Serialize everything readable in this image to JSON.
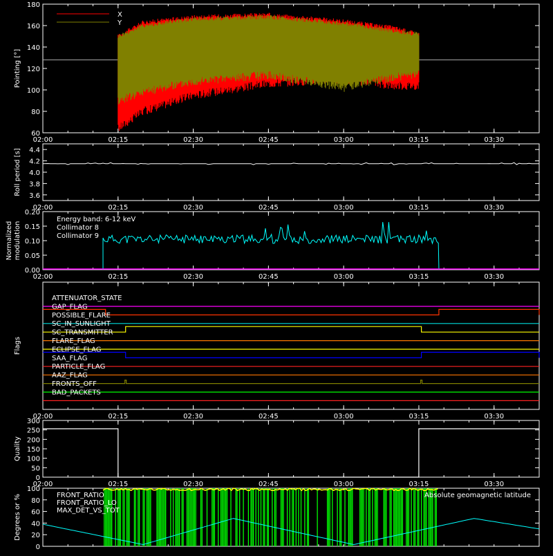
{
  "chart_data": [
    {
      "type": "line",
      "ylabel": "Pointing [°]",
      "ylim": [
        60,
        180
      ],
      "yticks": [
        "60",
        "80",
        "100",
        "120",
        "140",
        "160",
        "180"
      ],
      "xlim_minutes": [
        0,
        99
      ],
      "xticks": [
        "02:00",
        "02:15",
        "02:30",
        "02:45",
        "03:00",
        "03:15",
        "03:30"
      ],
      "legend": [
        {
          "label": "X",
          "color": "#ff0000"
        },
        {
          "label": "Y",
          "color": "#808000"
        }
      ],
      "reference_line": {
        "y": 128,
        "color": "#aaaaaa"
      },
      "series": [
        {
          "name": "X",
          "color": "#ff0000",
          "active_range": [
            "02:15",
            "03:15"
          ],
          "x": [
            "02:15",
            "02:20",
            "02:30",
            "02:45",
            "03:00",
            "03:10",
            "03:15"
          ],
          "upper": [
            150,
            163,
            168,
            170,
            164,
            158,
            152
          ],
          "lower": [
            64,
            80,
            95,
            106,
            110,
            104,
            104
          ]
        },
        {
          "name": "Y",
          "color": "#808000",
          "active_range": [
            "02:15",
            "03:15"
          ],
          "x": [
            "02:15",
            "02:20",
            "02:30",
            "02:45",
            "03:00",
            "03:10",
            "03:15"
          ],
          "upper": [
            150,
            160,
            166,
            168,
            162,
            155,
            152
          ],
          "lower": [
            90,
            98,
            108,
            114,
            102,
            112,
            114
          ]
        }
      ]
    },
    {
      "type": "line",
      "ylabel": "Roll period [s]",
      "ylim": [
        3.5,
        4.5
      ],
      "yticks": [
        "3.6",
        "3.8",
        "4.0",
        "4.2",
        "4.4"
      ],
      "xticks": [
        "02:00",
        "02:15",
        "02:30",
        "02:45",
        "03:00",
        "03:15",
        "03:30"
      ],
      "series": [
        {
          "color": "#ffffff",
          "value": 4.15
        }
      ]
    },
    {
      "type": "line",
      "ylabel": "Normalized modulation",
      "ylim": [
        0,
        0.2
      ],
      "yticks": [
        "0.00",
        "0.05",
        "0.10",
        "0.15",
        "0.20"
      ],
      "xticks": [
        "02:00",
        "02:15",
        "02:30",
        "02:45",
        "03:00",
        "03:15",
        "03:30"
      ],
      "annotation": "Energy band: 6-12 keV",
      "legend": [
        {
          "label": "Collimator 8",
          "color": "#00ffff"
        },
        {
          "label": "Collimator 9",
          "color": "#ff00ff"
        }
      ],
      "series": [
        {
          "name": "Collimator 8",
          "color": "#00ffff",
          "active_range": [
            "02:12",
            "03:19"
          ],
          "baseline": 0.105,
          "spread": 0.03
        },
        {
          "name": "Collimator 9",
          "color": "#ff00ff",
          "value": 0.0
        }
      ]
    },
    {
      "type": "line",
      "ylabel": "Flags",
      "xticks": [
        "02:00",
        "02:15",
        "02:30",
        "02:45",
        "03:00",
        "03:15",
        "03:30"
      ],
      "flags": [
        {
          "label": "ATTENUATOR_STATE",
          "color": "#ff00ff"
        },
        {
          "label": "GAP_FLAG",
          "color": "#ff3300",
          "high": [
            [
              0,
              12.5
            ],
            [
              79,
              99
            ]
          ]
        },
        {
          "label": "POSSIBLE_FLARE",
          "color": "#00dddd"
        },
        {
          "label": "SC_IN_SUNLIGHT",
          "color": "#ffff00",
          "high": [
            [
              16.5,
              75.5
            ]
          ]
        },
        {
          "label": "SC_TRANSMITTER",
          "color": "#ff7700"
        },
        {
          "label": "FLARE_FLAG",
          "color": "#ffff00"
        },
        {
          "label": "ECLIPSE_FLAG",
          "color": "#0000ff",
          "high": [
            [
              0,
              16.5
            ],
            [
              75.5,
              99
            ]
          ]
        },
        {
          "label": "SAA_FLAG",
          "color": "#ff2222"
        },
        {
          "label": "PARTICLE_FLAG",
          "color": "#ff7700"
        },
        {
          "label": "AAZ_FLAG",
          "color": "#808000",
          "spikes": [
            16.5,
            75.5
          ]
        },
        {
          "label": "FRONTS_OFF",
          "color": "#00ff00"
        },
        {
          "label": "BAD_PACKETS",
          "color": "#ff2222"
        }
      ]
    },
    {
      "type": "line",
      "ylabel": "Quality",
      "ylim": [
        0,
        300
      ],
      "yticks": [
        "0",
        "50",
        "100",
        "150",
        "200",
        "250",
        "300"
      ],
      "xticks": [
        "02:00",
        "02:15",
        "02:30",
        "02:45",
        "03:00",
        "03:15",
        "03:30"
      ],
      "series": [
        {
          "color": "#ffffff",
          "x": [
            "02:00",
            "02:15",
            "02:15",
            "03:15",
            "03:15",
            "03:39"
          ],
          "y": [
            256,
            256,
            0,
            0,
            256,
            256
          ]
        }
      ]
    },
    {
      "type": "line",
      "ylabel": "Degrees or %",
      "ylim": [
        0,
        100
      ],
      "yticks": [
        "0",
        "20",
        "40",
        "60",
        "80",
        "100"
      ],
      "legend": [
        {
          "label": "FRONT_RATIO",
          "color": "#ffff00"
        },
        {
          "label": "FRONT_RATIO_LO",
          "color": "#00ff00"
        },
        {
          "label": "MAX_DET_VS_TOT",
          "color": "#ff7700"
        }
      ],
      "annotation": "Absolute geomagnetic latitude",
      "annotation_color": "#00ffff",
      "series": [
        {
          "name": "Absolute geomagnetic latitude",
          "color": "#00ffff",
          "x": [
            "02:00",
            "02:20",
            "02:38",
            "03:02",
            "03:26",
            "03:39"
          ],
          "y": [
            38,
            3,
            48,
            3,
            48,
            30
          ]
        },
        {
          "name": "FRONT_RATIO",
          "color": "#ffff00",
          "active_range": [
            "02:12",
            "03:19"
          ],
          "value": 98
        },
        {
          "name": "FRONT_RATIO_LO",
          "color": "#00ff00",
          "active_range": [
            "02:12",
            "03:19"
          ]
        }
      ]
    }
  ]
}
